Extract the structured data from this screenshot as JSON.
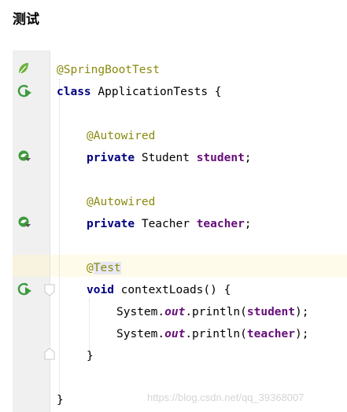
{
  "heading": "测试",
  "code": {
    "lines": [
      {
        "annotation": "@SpringBootTest"
      },
      {
        "keyword": "class",
        "rest": " ApplicationTests {"
      },
      {
        "annotation": "@Autowired"
      },
      {
        "keyword": "private",
        "type": " Student ",
        "field": "student",
        "end": ";"
      },
      {
        "annotation": "@Autowired"
      },
      {
        "keyword": "private",
        "type": " Teacher ",
        "field": "teacher",
        "end": ";"
      },
      {
        "annotation_prefix": "@",
        "annotation_rest": "Test"
      },
      {
        "keyword": "void",
        "rest": " contextLoads() {"
      },
      {
        "obj": "System.",
        "static_field": "out",
        "call": ".println(",
        "field": "student",
        "end": ");"
      },
      {
        "obj": "System.",
        "static_field": "out",
        "call": ".println(",
        "field": "teacher",
        "end": ");"
      },
      {
        "text": "}"
      },
      {
        "text": "}"
      }
    ]
  },
  "gutter_icons": [
    "spring-leaf-icon",
    "run-test-icon",
    "autowired-bean-icon",
    "autowired-bean-icon",
    "run-test-icon",
    "fold-icon",
    "fold-end-icon"
  ],
  "watermark": "https://blog.csdn.net/qq_39368007",
  "colors": {
    "annotation": "#8a8a10",
    "keyword": "#000080",
    "field": "#660e7a",
    "gutter": "#f0f0f0",
    "current_line": "#fefbea",
    "run_icon": "#3d9b3d"
  }
}
